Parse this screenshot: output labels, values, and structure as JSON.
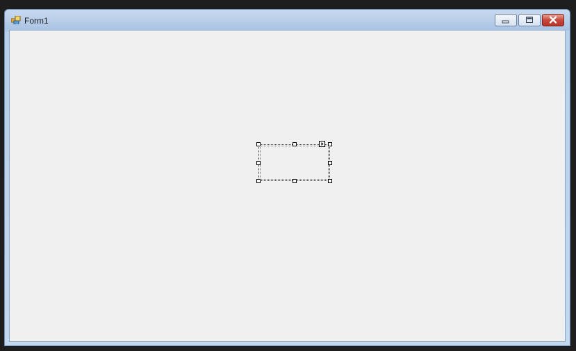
{
  "window": {
    "title": "Form1",
    "icons": {
      "app": "form-app-icon",
      "minimize": "minimize-icon",
      "maximize": "maximize-icon",
      "close": "close-icon"
    }
  },
  "designer": {
    "selected_control": "unnamed-control",
    "smart_tag_icon": "smart-tag-arrow-icon"
  }
}
